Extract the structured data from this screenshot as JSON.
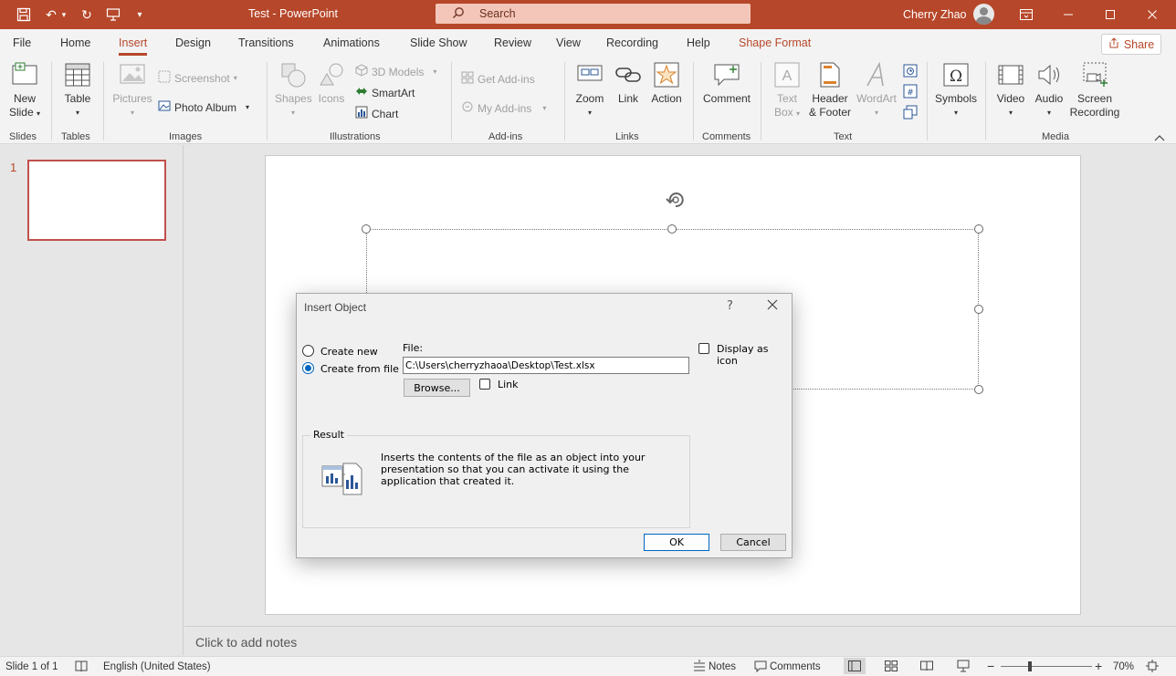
{
  "window": {
    "title": "Test  -  PowerPoint",
    "search_placeholder": "Search",
    "user_name": "Cherry Zhao"
  },
  "tabs": [
    "File",
    "Home",
    "Insert",
    "Design",
    "Transitions",
    "Animations",
    "Slide Show",
    "Review",
    "View",
    "Recording",
    "Help",
    "Shape Format"
  ],
  "active_tab": "Insert",
  "share_label": "Share",
  "ribbon": {
    "groups": {
      "slides": "Slides",
      "tables": "Tables",
      "images": "Images",
      "illustrations": "Illustrations",
      "addins": "Add-ins",
      "links": "Links",
      "comments": "Comments",
      "text": "Text",
      "media": "Media"
    },
    "new_slide": [
      "New",
      "Slide"
    ],
    "table": "Table",
    "pictures": "Pictures",
    "screenshot": "Screenshot",
    "photo_album": "Photo Album",
    "shapes": "Shapes",
    "icons": "Icons",
    "models3d": "3D Models",
    "smartart": "SmartArt",
    "chart": "Chart",
    "get_addins": "Get Add-ins",
    "my_addins": "My Add-ins",
    "zoom": "Zoom",
    "link": "Link",
    "action": "Action",
    "comment": "Comment",
    "text_box": [
      "Text",
      "Box"
    ],
    "header_footer": [
      "Header",
      "& Footer"
    ],
    "wordart": "WordArt",
    "symbols": "Symbols",
    "video": "Video",
    "audio": "Audio",
    "screen_recording": [
      "Screen",
      "Recording"
    ]
  },
  "thumbnail": {
    "number": "1"
  },
  "notes_placeholder": "Click to add notes",
  "status": {
    "slide": "Slide 1 of 1",
    "language": "English (United States)",
    "notes": "Notes",
    "comments": "Comments",
    "zoom": "70%"
  },
  "dialog": {
    "title": "Insert Object",
    "help": "?",
    "create_new": "Create new",
    "create_from_file": "Create from file",
    "selected_option": "create_from_file",
    "file_label": "File:",
    "file_path": "C:\\Users\\cherryzhaoa\\Desktop\\Test.xlsx",
    "browse": "Browse...",
    "link": "Link",
    "link_checked": false,
    "display_as_icon": "Display as icon",
    "display_as_icon_checked": false,
    "result_label": "Result",
    "result_text": "Inserts the contents of the file as an object into your presentation so that you can activate it using the application that created it.",
    "ok": "OK",
    "cancel": "Cancel"
  },
  "colors": {
    "accent": "#b7472a",
    "dialog_accent": "#0067c0"
  }
}
